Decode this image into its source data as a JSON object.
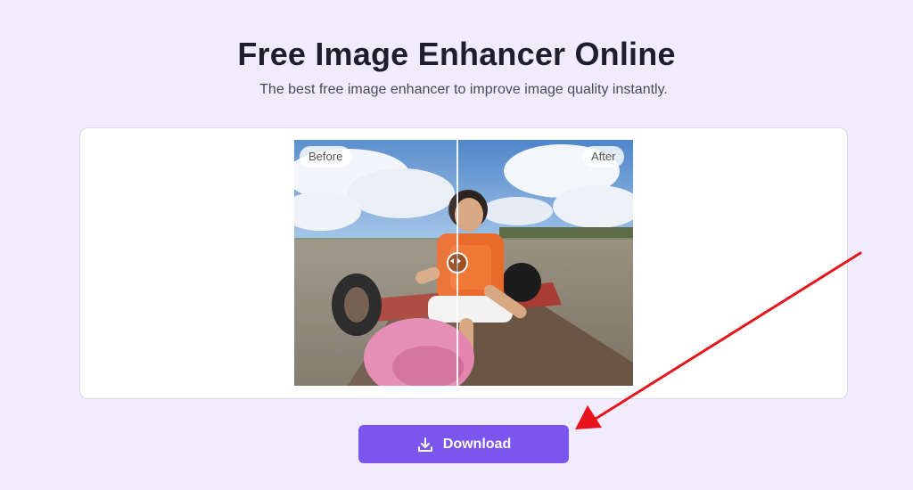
{
  "header": {
    "title": "Free Image Enhancer Online",
    "subtitle": "The best free image enhancer to improve image quality instantly."
  },
  "preview": {
    "before_label": "Before",
    "after_label": "After",
    "slider_position_percent": 48
  },
  "actions": {
    "download_label": "Download",
    "download_icon": "download-icon"
  },
  "colors": {
    "background": "#f1ecfb",
    "accent": "#7b55ee",
    "annotation_arrow": "#e8141c"
  }
}
